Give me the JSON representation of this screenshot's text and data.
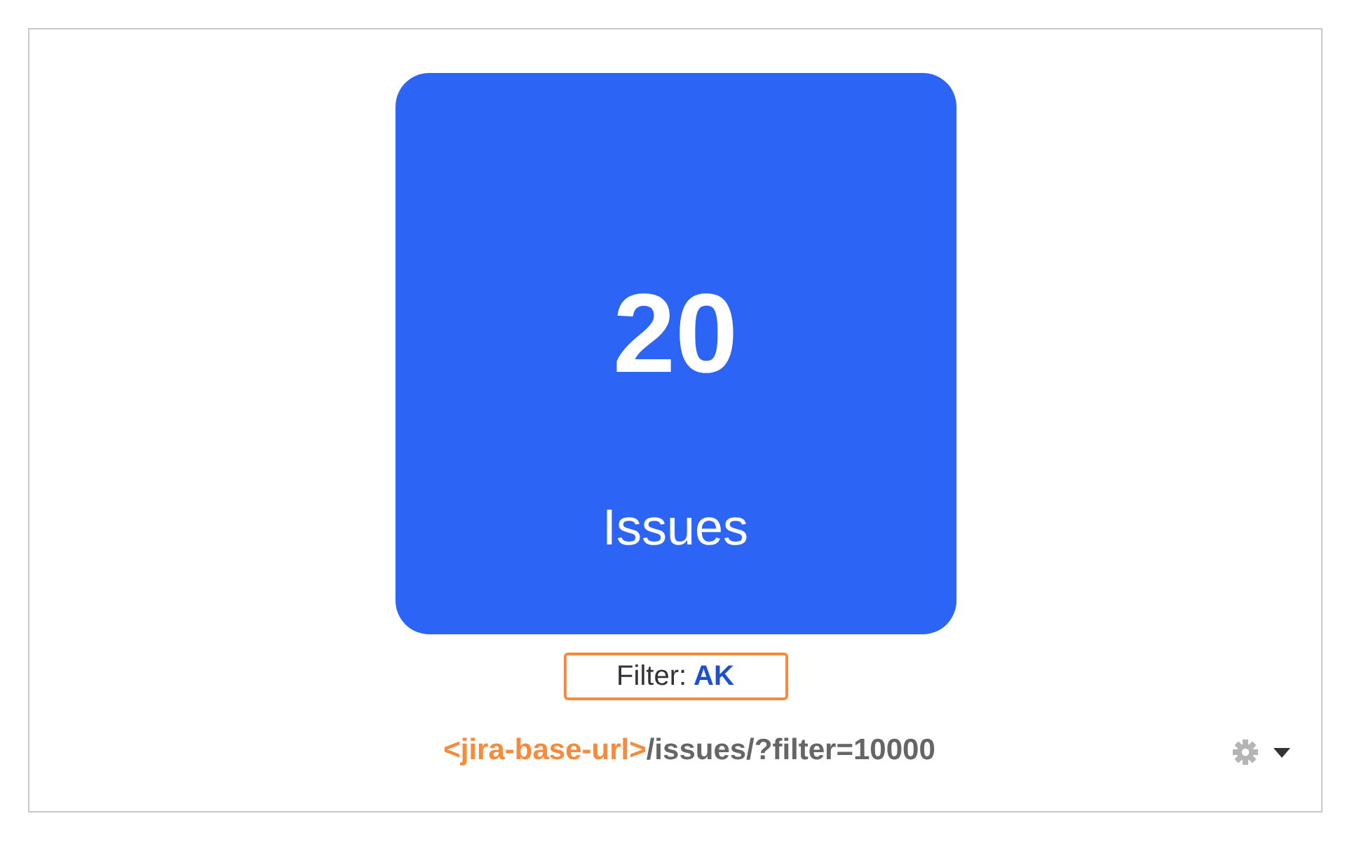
{
  "tile": {
    "count": "20",
    "label": "Issues"
  },
  "filter": {
    "label": "Filter:",
    "value": "AK"
  },
  "link": {
    "base": "<jira-base-url>",
    "path": "/issues/?filter=10000"
  }
}
